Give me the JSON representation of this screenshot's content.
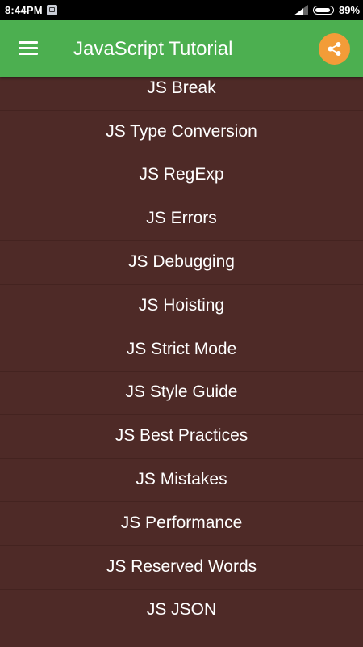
{
  "status_bar": {
    "time": "8:44PM",
    "battery_percent": "89%",
    "battery_level": 0.89,
    "icons": [
      "notification-icon",
      "signal-icon",
      "battery-icon"
    ]
  },
  "app_bar": {
    "menu_icon": "hamburger-menu-icon",
    "title": "JavaScript Tutorial",
    "share_icon": "share-icon",
    "colors": {
      "bar": "#4caf50",
      "share_button": "#f39c38"
    }
  },
  "topics": {
    "background_color": "#4e2a27",
    "items": [
      "JS Break",
      "JS Type Conversion",
      "JS RegExp",
      "JS Errors",
      "JS Debugging",
      "JS Hoisting",
      "JS Strict Mode",
      "JS Style Guide",
      "JS Best Practices",
      "JS Mistakes",
      "JS Performance",
      "JS Reserved Words",
      "JS JSON"
    ]
  }
}
